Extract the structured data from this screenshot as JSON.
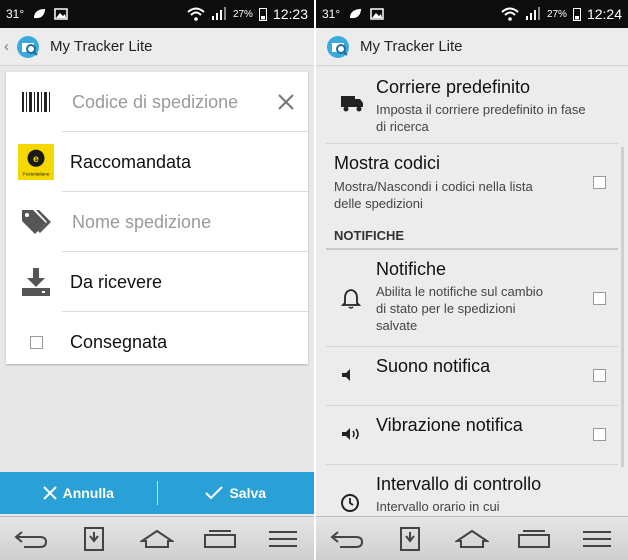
{
  "left": {
    "status": {
      "temp": "31°",
      "battery": "27%",
      "time": "12:23"
    },
    "app_title": "My Tracker Lite",
    "form": {
      "tracking_code_placeholder": "Codice di spedizione",
      "carrier": "Raccomandata",
      "carrier_logo_text": "Posteitaliane",
      "shipment_name_placeholder": "Nome spedizione",
      "direction": "Da ricevere",
      "delivered_label": "Consegnata"
    },
    "actions": {
      "cancel": "Annulla",
      "save": "Salva"
    }
  },
  "right": {
    "status": {
      "temp": "31°",
      "battery": "27%",
      "time": "12:24"
    },
    "app_title": "My Tracker Lite",
    "settings": {
      "default_carrier": {
        "title": "Corriere predefinito",
        "summary": "Imposta il corriere predefinito in fase di ricerca"
      },
      "show_codes": {
        "title": "Mostra codici",
        "summary": "Mostra/Nascondi i codici nella lista delle spedizioni"
      },
      "section_notifications": "NOTIFICHE",
      "notifications": {
        "title": "Notifiche",
        "summary": "Abilita le notifiche sul cambio di stato per le spedizioni salvate"
      },
      "notification_sound": {
        "title": "Suono notifica"
      },
      "notification_vibration": {
        "title": "Vibrazione notifica"
      },
      "check_interval": {
        "title": "Intervallo di controllo",
        "summary": "Intervallo orario in cui"
      }
    }
  },
  "colors": {
    "accent": "#29a0d6",
    "statusbar": "#0d0d0d",
    "poste_yellow": "#f5d800"
  }
}
